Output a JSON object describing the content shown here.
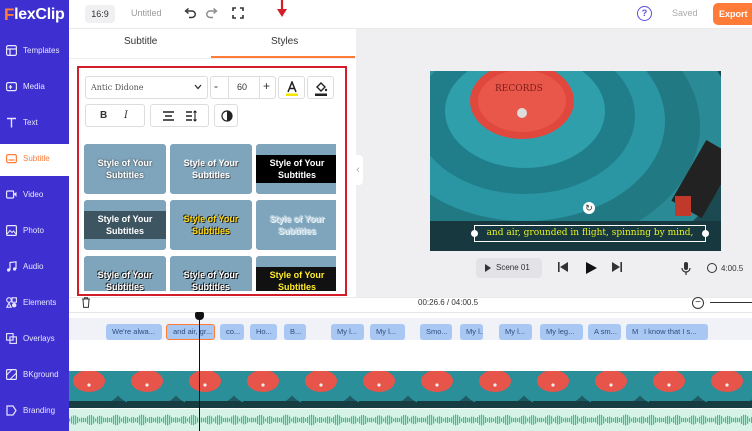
{
  "app": {
    "logo_mark": "F",
    "logo_text": "lexClip"
  },
  "topbar": {
    "aspect_ratio": "16:9",
    "title": "Untitled",
    "icons": [
      "undo-icon",
      "redo-icon",
      "fullscreen-icon"
    ],
    "help_icon": "?",
    "saved_label": "Saved",
    "export_label": "Export"
  },
  "sidebar": {
    "items": [
      {
        "label": "Templates",
        "icon": "templates-icon"
      },
      {
        "label": "Media",
        "icon": "media-icon"
      },
      {
        "label": "Text",
        "icon": "text-icon"
      },
      {
        "label": "Subtitle",
        "icon": "subtitle-icon",
        "active": true
      },
      {
        "label": "Video",
        "icon": "video-icon"
      },
      {
        "label": "Photo",
        "icon": "photo-icon"
      },
      {
        "label": "Audio",
        "icon": "audio-icon"
      },
      {
        "label": "Elements",
        "icon": "elements-icon"
      },
      {
        "label": "Overlays",
        "icon": "overlays-icon"
      },
      {
        "label": "BKground",
        "icon": "background-icon"
      },
      {
        "label": "Branding",
        "icon": "branding-icon"
      }
    ]
  },
  "panel": {
    "tabs": [
      {
        "label": "Subtitle",
        "active": false
      },
      {
        "label": "Styles",
        "active": true
      }
    ],
    "font_family": "Antic Didone",
    "font_size": "60",
    "minus": "-",
    "plus": "+",
    "text_color_glyph": "A",
    "bold": "B",
    "italic": "I",
    "styles": [
      "Style of Your Subtitles",
      "Style of Your Subtitles",
      "Style of Your Subtitles",
      "Style of Your Subtitles",
      "Style of Your Subtitles",
      "Style of Your Subtitles",
      "Style of Your Subtitles",
      "Style of Your Subtitles",
      "Style of Your Subtitles"
    ]
  },
  "preview": {
    "subtitle_text": "and air, grounded in flight, spinning by mind,",
    "scene_label": "Scene 01",
    "duration": "4:00.5"
  },
  "timeline": {
    "time_code": "00:26.6 / 04:00.5",
    "subtitle_chips": [
      "We're alwa...",
      "and air, gr...",
      "co...",
      "Ho...",
      "B...",
      "My l...",
      "My l...",
      "Smo...",
      "My l...",
      "My l...",
      "My leg...",
      "A sm...",
      "My l...",
      "I know that I s..."
    ]
  },
  "colors": {
    "sidebar": "#3d2fd0",
    "accent": "#ff7b38",
    "annotation_red": "#d21e2a",
    "subtitle_yellow": "#e6f222"
  }
}
